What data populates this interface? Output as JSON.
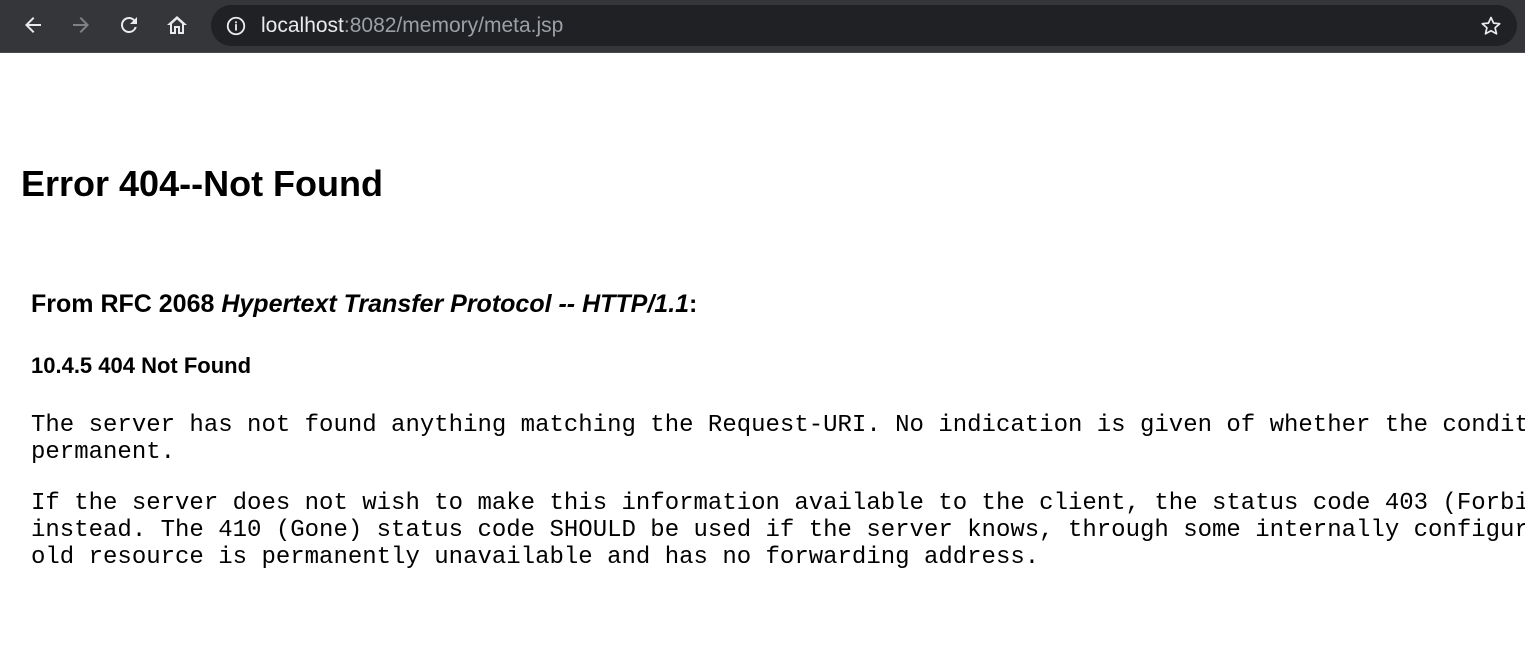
{
  "browser": {
    "url_host": "localhost",
    "url_rest": ":8082/memory/meta.jsp",
    "icons": {
      "back": "back-arrow-icon",
      "forward": "forward-arrow-icon",
      "reload": "reload-icon",
      "home": "home-icon",
      "site_info": "info-icon",
      "bookmark": "star-icon"
    },
    "colors": {
      "toolbar_bg": "#35363a",
      "omnibox_bg": "#202124",
      "url_host": "#e8eaed",
      "url_rest": "#9aa0a6"
    }
  },
  "page": {
    "title": "Error 404--Not Found",
    "rfc_prefix": "From RFC 2068 ",
    "rfc_title": "Hypertext Transfer Protocol -- HTTP/1.1",
    "rfc_suffix": ":",
    "section_heading": "10.4.5 404 Not Found",
    "para1_line1": "The server has not found anything matching the Request-URI. No indication is given of whether the condit",
    "para1_line2": "permanent.",
    "para2_line1": "If the server does not wish to make this information available to the client, the status code 403 (Forbi",
    "para2_line2": "instead. The 410 (Gone) status code SHOULD be used if the server knows, through some internally configur",
    "para2_line3": "old resource is permanently unavailable and has no forwarding address."
  }
}
